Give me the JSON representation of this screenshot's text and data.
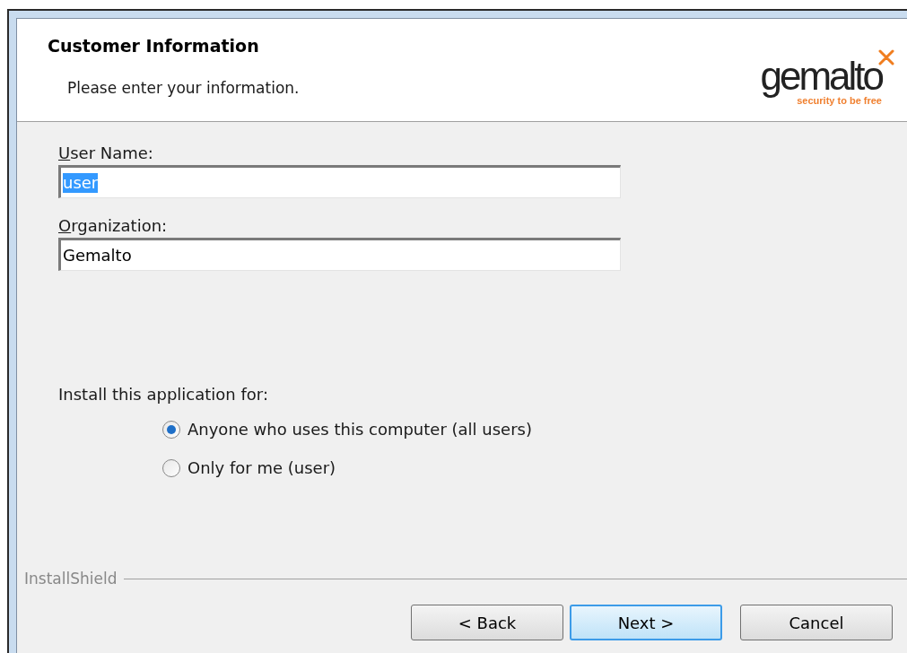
{
  "header": {
    "title": "Customer Information",
    "subtitle": "Please enter your information.",
    "logo": {
      "name": "gemalto",
      "tagline": "security to be free"
    }
  },
  "fields": [
    {
      "label": "User Name:",
      "mnemonic_first": true,
      "value": "user",
      "text_selected": true
    },
    {
      "label": "Organization:",
      "mnemonic_first": true,
      "value": "Gemalto",
      "text_selected": false
    }
  ],
  "install_for": {
    "label": "Install this application for:",
    "options": [
      {
        "label": "Anyone who uses this computer (all users)",
        "selected": true
      },
      {
        "label": "Only for me (user)",
        "selected": false
      }
    ]
  },
  "footer": {
    "brand": "InstallShield",
    "buttons": [
      {
        "label": "< Back",
        "default": false
      },
      {
        "label": "Next >",
        "default": true
      },
      {
        "label": "Cancel",
        "default": false
      }
    ]
  }
}
